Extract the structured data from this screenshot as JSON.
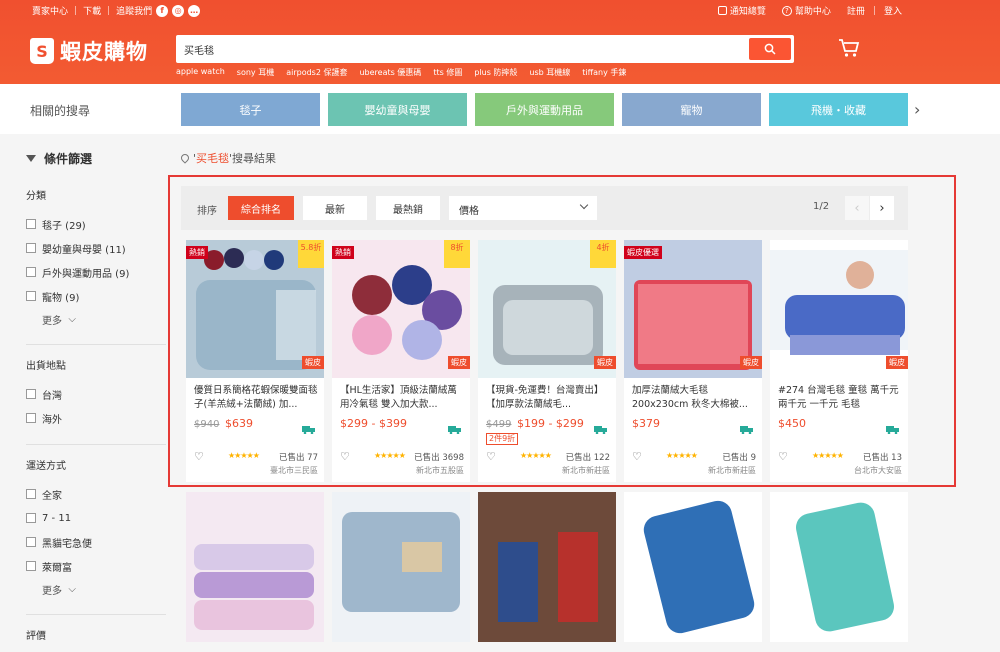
{
  "topbar": {
    "seller_center": "賣家中心",
    "download": "下載",
    "follow": "追蹤我們",
    "notifications": "通知總覽",
    "help": "幫助中心",
    "register": "註冊",
    "login": "登入"
  },
  "logo": {
    "text": "蝦皮購物"
  },
  "search": {
    "value": "买毛毯"
  },
  "hot_words": [
    "apple watch",
    "sony 耳機",
    "airpods2 保護套",
    "ubereats 優惠碼",
    "tts 修圖",
    "plus 防摔殼",
    "usb 耳機線",
    "tiffany 手鍊"
  ],
  "related": {
    "label": "相關的搜尋",
    "categories": [
      {
        "label": "毯子",
        "color": "#7fa8d3"
      },
      {
        "label": "嬰幼童與母嬰",
        "color": "#6cc4b2"
      },
      {
        "label": "戶外與運動用品",
        "color": "#86c97b"
      },
      {
        "label": "寵物",
        "color": "#88a8cf"
      },
      {
        "label": "飛機・收藏",
        "color": "#59c8dc"
      }
    ]
  },
  "filters": {
    "title": "條件篩選",
    "category": {
      "title": "分類",
      "options": [
        "毯子 (29)",
        "嬰幼童與母嬰 (11)",
        "戶外與運動用品 (9)",
        "寵物 (9)"
      ],
      "more": "更多"
    },
    "location": {
      "title": "出貨地點",
      "options": [
        "台灣",
        "海外"
      ]
    },
    "shipping": {
      "title": "運送方式",
      "options": [
        "全家",
        "7 - 11",
        "黑貓宅急便",
        "萊爾富"
      ],
      "more": "更多"
    },
    "rating_title": "評價"
  },
  "results": {
    "prefix": "'",
    "keyword": "买毛毯",
    "suffix": "'搜尋結果"
  },
  "sort": {
    "label": "排序",
    "relevance": "綜合排名",
    "latest": "最新",
    "top_sales": "最熱銷",
    "price": "價格",
    "page": "1/2"
  },
  "products": [
    {
      "name": "優質日系簡格花蝦保暖雙面毯子(羊羔絨+法蘭絨) 加...",
      "orig": "$940",
      "price": "$639",
      "sold": "已售出 77",
      "loc": "臺北市三民區",
      "tag_left": "熱銷",
      "tag_right": "5.8折",
      "stars": "★★★★★",
      "promo": "",
      "like": "蝦皮"
    },
    {
      "name": "【HL生活家】頂級法蘭絨萬用冷氣毯 雙入加大款...",
      "orig": "",
      "price": "$299 - $399",
      "sold": "已售出 3698",
      "loc": "新北市五股區",
      "tag_left": "熱銷",
      "tag_right": "8折",
      "stars": "★★★★★",
      "promo": "",
      "like": "蝦皮"
    },
    {
      "name": "【現貨-免運費！台灣賣出】【加厚款法蘭絨毛...",
      "orig": "$499",
      "price": "$199 - $299",
      "sold": "已售出 122",
      "loc": "新北市新莊區",
      "tag_left": "",
      "tag_right": "4折",
      "stars": "★★★★★",
      "promo": "2件9折",
      "like": "蝦皮"
    },
    {
      "name": "加厚法蘭絨大毛毯 200x230cm 秋冬大棉被...",
      "orig": "",
      "price": "$379",
      "sold": "已售出 9",
      "loc": "新北市新莊區",
      "tag_left": "蝦皮優選",
      "tag_right": "",
      "stars": "★★★★★",
      "promo": "",
      "like": "蝦皮"
    },
    {
      "name": "#274 台灣毛毯 童毯 萬千元 兩千元 一千元 毛毯",
      "orig": "",
      "price": "$450",
      "sold": "已售出 13",
      "loc": "台北市大安區",
      "tag_left": "",
      "tag_right": "",
      "stars": "★★★★★",
      "promo": "",
      "like": "蝦皮"
    }
  ]
}
